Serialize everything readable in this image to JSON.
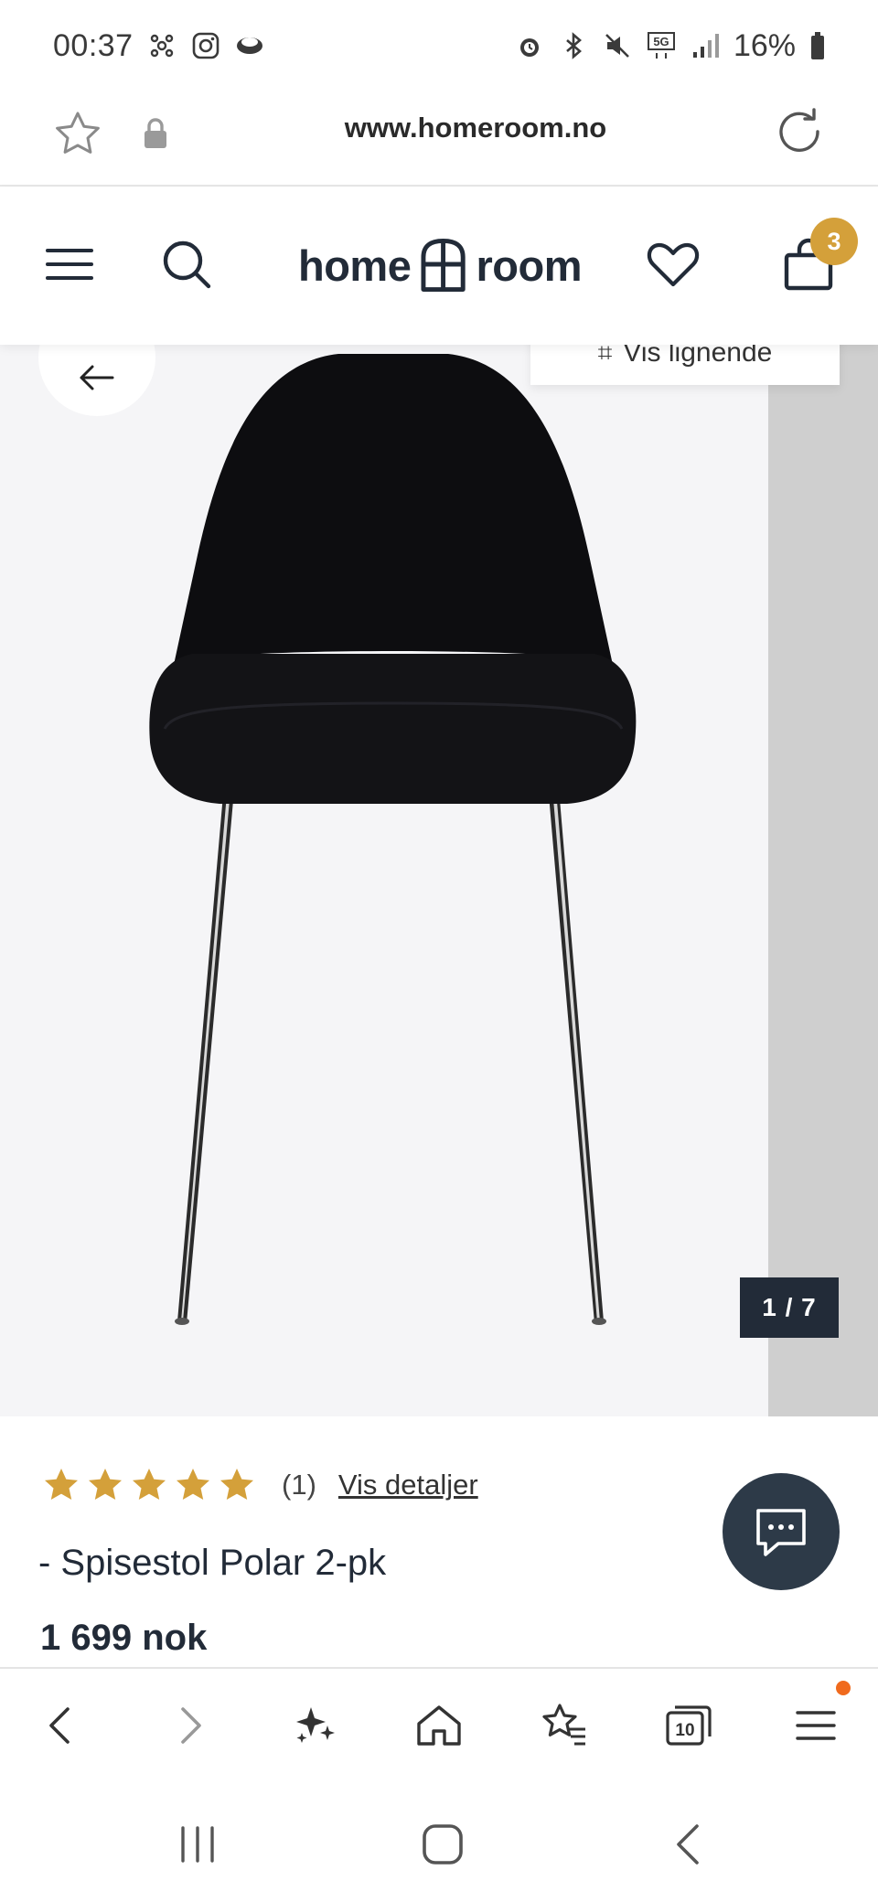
{
  "status_bar": {
    "time": "00:37",
    "battery": "16%",
    "network": "5G",
    "left_icons": [
      "network-app-icon",
      "instagram-icon",
      "planet-icon"
    ],
    "right_icons": [
      "alarm-icon",
      "bluetooth-icon",
      "mute-icon",
      "5g-icon",
      "signal-icon",
      "battery-icon"
    ]
  },
  "url_bar": {
    "url": "www.homeroom.no"
  },
  "header": {
    "logo_left": "home",
    "logo_right": "room",
    "cart_count": "3"
  },
  "gallery": {
    "similar_label": "Vis lignende",
    "counter": "1 / 7"
  },
  "product": {
    "rating": 5,
    "review_count": "(1)",
    "details_link": "Vis detaljer",
    "title": "-  Spisestol Polar 2-pk",
    "price": "1 699 nok"
  },
  "colors": {
    "brand_dark": "#222b38",
    "accent_gold": "#d4a03a",
    "chat_fab": "#2d3a48",
    "notification_dot": "#f06a1d"
  }
}
